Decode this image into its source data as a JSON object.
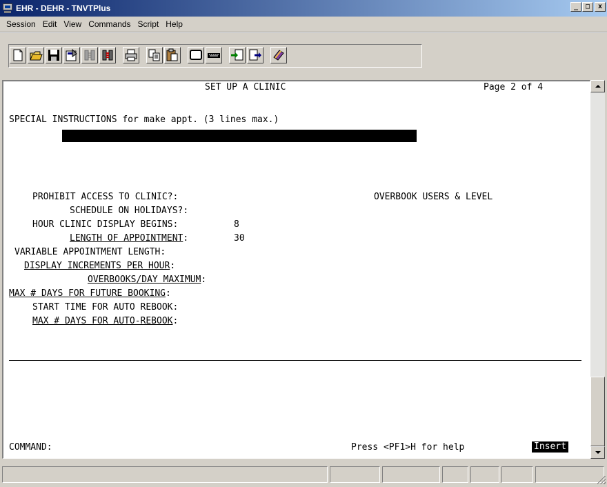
{
  "window": {
    "title": "EHR - DEHR - TNVTPlus",
    "buttons": {
      "minimize": "_",
      "maximize": "□",
      "close": "x"
    }
  },
  "menu": {
    "items": [
      {
        "label": "Session"
      },
      {
        "label": "Edit"
      },
      {
        "label": "View"
      },
      {
        "label": "Commands"
      },
      {
        "label": "Script"
      },
      {
        "label": "Help"
      }
    ]
  },
  "toolbar": {
    "buttons": [
      "new-icon",
      "open-icon",
      "save-icon",
      "properties-icon",
      "disconnect-icon",
      "connect-icon",
      "print-icon",
      "copy-icon",
      "paste-icon",
      "screen-icon",
      "keyboard-icon",
      "receive-file-icon",
      "send-file-icon",
      "help-book-icon"
    ]
  },
  "terminal": {
    "header_title": "SET UP A CLINIC",
    "page": "Page 2 of 4",
    "special_instructions": "SPECIAL INSTRUCTIONS for make appt. (3 lines max.)",
    "overbook_users": "OVERBOOK USERS & LEVEL",
    "fields": [
      {
        "label": "PROHIBIT ACCESS TO CLINIC?:",
        "value": ""
      },
      {
        "label": "SCHEDULE ON HOLIDAYS?:",
        "value": ""
      },
      {
        "label": "HOUR CLINIC DISPLAY BEGINS:",
        "value": "8"
      },
      {
        "label": "LENGTH OF APPOINTMENT",
        "suffix": ":",
        "value": "30"
      },
      {
        "label": "VARIABLE APPOINTMENT LENGTH:",
        "value": ""
      },
      {
        "label": "DISPLAY INCREMENTS PER HOUR",
        "suffix": ":",
        "value": ""
      },
      {
        "label": "OVERBOOKS/DAY MAXIMUM",
        "suffix": ":",
        "value": ""
      },
      {
        "label": "MAX # DAYS FOR FUTURE BOOKING",
        "suffix": ":",
        "value": ""
      },
      {
        "label": "START TIME FOR AUTO REBOOK:",
        "value": ""
      },
      {
        "label": "MAX # DAYS FOR AUTO-REBOOK",
        "suffix": ":",
        "value": ""
      }
    ],
    "command_label": "COMMAND:",
    "help_text": "Press <PF1>H for help",
    "insert_mode": "Insert"
  },
  "colors": {
    "titlebar_start": "#0a246a",
    "titlebar_end": "#a6caf0",
    "chrome": "#d4d0c8",
    "terminal_bg": "#ffffff"
  }
}
